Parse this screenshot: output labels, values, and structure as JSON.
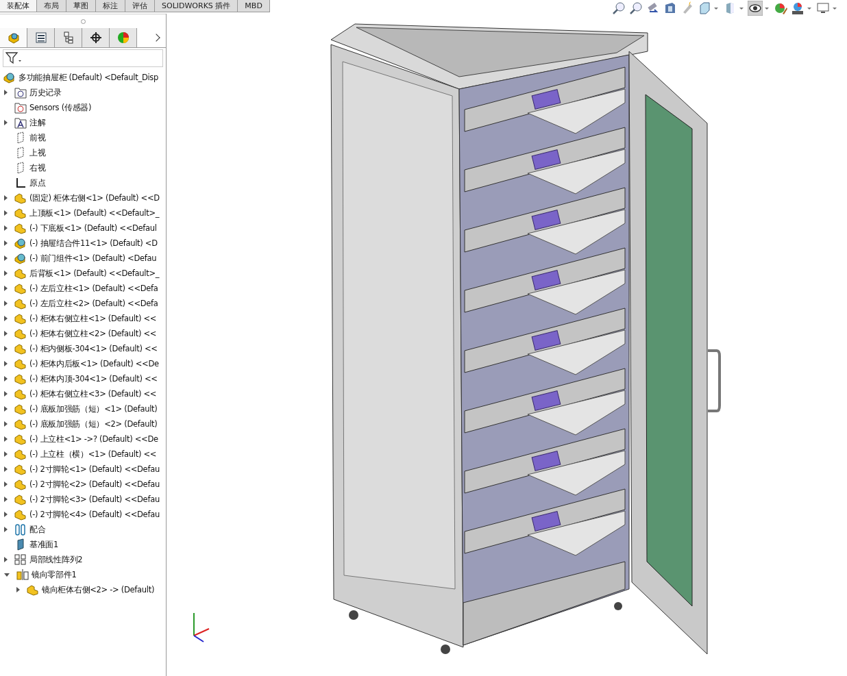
{
  "command_tabs": [
    {
      "label": "装配体",
      "selected": true
    },
    {
      "label": "布局",
      "selected": false
    },
    {
      "label": "草图",
      "selected": false
    },
    {
      "label": "标注",
      "selected": false
    },
    {
      "label": "评估",
      "selected": false
    },
    {
      "label": "SOLIDWORKS 插件",
      "selected": false
    },
    {
      "label": "MBD",
      "selected": false
    }
  ],
  "view_toolbar": [
    {
      "kind": "zoomfit",
      "selected": false,
      "dropdown": false
    },
    {
      "kind": "zoomarea",
      "selected": false,
      "dropdown": false
    },
    {
      "kind": "previous",
      "selected": false,
      "dropdown": false
    },
    {
      "kind": "section",
      "selected": false,
      "dropdown": false
    },
    {
      "kind": "annotation",
      "selected": false,
      "dropdown": false
    },
    {
      "kind": "cube",
      "selected": false,
      "dropdown": true
    },
    {
      "kind": "shaded",
      "selected": false,
      "dropdown": true
    },
    {
      "kind": "eye",
      "selected": true,
      "dropdown": true
    },
    {
      "kind": "appearance",
      "selected": false,
      "dropdown": false
    },
    {
      "kind": "scene",
      "selected": false,
      "dropdown": true
    },
    {
      "kind": "monitor",
      "selected": false,
      "dropdown": true
    }
  ],
  "panel_tabs": [
    {
      "kind": "tree",
      "selected": true
    },
    {
      "kind": "property",
      "selected": false
    },
    {
      "kind": "config",
      "selected": false
    },
    {
      "kind": "dimxpert",
      "selected": false
    },
    {
      "kind": "display",
      "selected": false
    }
  ],
  "tree": {
    "label": "多功能抽屉柜 (Default) <Default_Disp",
    "kind": "assembly",
    "children": [
      {
        "label": "历史记录",
        "kind": "history",
        "expanded": false
      },
      {
        "label": "Sensors (传感器)",
        "kind": "sensor"
      },
      {
        "label": "注解",
        "kind": "annotation",
        "expanded": false
      },
      {
        "label": "前视",
        "kind": "plane"
      },
      {
        "label": "上视",
        "kind": "plane"
      },
      {
        "label": "右视",
        "kind": "plane"
      },
      {
        "label": "原点",
        "kind": "origin"
      },
      {
        "label": "(固定) 柜体右侧<1> (Default) <<D",
        "kind": "part",
        "expanded": false
      },
      {
        "label": "上顶板<1> (Default) <<Default>_",
        "kind": "part",
        "expanded": false
      },
      {
        "label": "(-) 下底板<1> (Default) <<Defaul",
        "kind": "part",
        "expanded": false
      },
      {
        "label": "(-) 抽屉结合件11<1> (Default) <D",
        "kind": "assembly",
        "expanded": false
      },
      {
        "label": "(-) 前门组件<1> (Default) <Defau",
        "kind": "assembly",
        "expanded": false
      },
      {
        "label": "后背板<1> (Default) <<Default>_",
        "kind": "part",
        "expanded": false
      },
      {
        "label": "(-) 左后立柱<1> (Default) <<Defa",
        "kind": "part",
        "expanded": false
      },
      {
        "label": "(-) 左后立柱<2> (Default) <<Defa",
        "kind": "part",
        "expanded": false
      },
      {
        "label": "(-) 柜体右侧立柱<1> (Default) <<",
        "kind": "part",
        "expanded": false
      },
      {
        "label": "(-) 柜体右侧立柱<2> (Default) <<",
        "kind": "part",
        "expanded": false
      },
      {
        "label": "(-) 柜内侧板-304<1> (Default) <<",
        "kind": "part",
        "expanded": false
      },
      {
        "label": "(-) 柜体内后板<1> (Default) <<De",
        "kind": "part",
        "expanded": false
      },
      {
        "label": "(-) 柜体内顶-304<1> (Default) <<",
        "kind": "part",
        "expanded": false
      },
      {
        "label": "(-) 柜体右侧立柱<3> (Default) <<",
        "kind": "part",
        "expanded": false
      },
      {
        "label": "(-) 底板加强筋（短）<1> (Default)",
        "kind": "part",
        "expanded": false
      },
      {
        "label": "(-) 底板加强筋（短）<2> (Default)",
        "kind": "part",
        "expanded": false
      },
      {
        "label": "(-) 上立柱<1> ->? (Default) <<De",
        "kind": "part",
        "expanded": false
      },
      {
        "label": "(-) 上立柱（横）<1> (Default) <<",
        "kind": "part",
        "expanded": false
      },
      {
        "label": "(-) 2寸脚轮<1> (Default) <<Defau",
        "kind": "part",
        "expanded": false
      },
      {
        "label": "(-) 2寸脚轮<2> (Default) <<Defau",
        "kind": "part",
        "expanded": false
      },
      {
        "label": "(-) 2寸脚轮<3> (Default) <<Defau",
        "kind": "part",
        "expanded": false
      },
      {
        "label": "(-) 2寸脚轮<4> (Default) <<Defau",
        "kind": "part",
        "expanded": false
      },
      {
        "label": "配合",
        "kind": "mates",
        "expanded": false
      },
      {
        "label": "基准面1",
        "kind": "planesolid"
      },
      {
        "label": "局部线性阵列2",
        "kind": "pattern",
        "expanded": false
      },
      {
        "label": "镜向零部件1",
        "kind": "mirror",
        "expanded": true,
        "children": [
          {
            "label": "镜向柜体右侧<2> -> (Default)",
            "kind": "part",
            "expanded": false
          }
        ]
      }
    ]
  }
}
